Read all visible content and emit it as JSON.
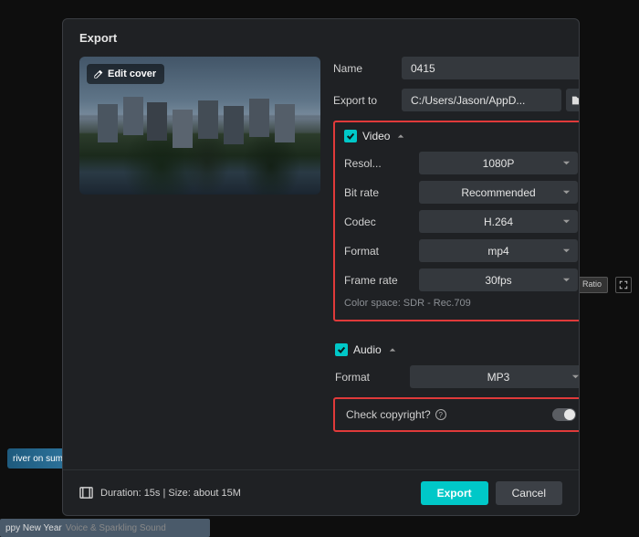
{
  "modal": {
    "title": "Export",
    "cover": {
      "edit_label": "Edit cover"
    },
    "form": {
      "name_label": "Name",
      "name_value": "0415",
      "export_to_label": "Export to",
      "export_to_value": "C:/Users/Jason/AppD..."
    },
    "video": {
      "header": "Video",
      "resolution_label": "Resol...",
      "resolution_value": "1080P",
      "bitrate_label": "Bit rate",
      "bitrate_value": "Recommended",
      "codec_label": "Codec",
      "codec_value": "H.264",
      "format_label": "Format",
      "format_value": "mp4",
      "framerate_label": "Frame rate",
      "framerate_value": "30fps",
      "colorspace_info": "Color space: SDR - Rec.709"
    },
    "audio": {
      "header": "Audio",
      "format_label": "Format",
      "format_value": "MP3"
    },
    "copyright_label": "Check copyright?",
    "footer": {
      "duration_info": "Duration: 15s | Size: about 15M",
      "export_btn": "Export",
      "cancel_btn": "Cancel"
    }
  },
  "bg": {
    "ratio": "Ratio",
    "thumb1": "river on summ",
    "thumb2a": "ppy New Year",
    "thumb2b": "Voice & Sparkling Sound"
  }
}
